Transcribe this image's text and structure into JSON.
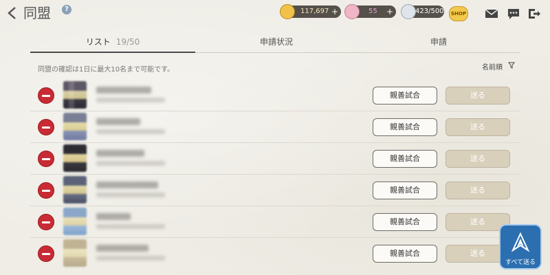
{
  "header": {
    "title": "同盟",
    "help": "?",
    "currencies": [
      {
        "name": "gold",
        "value": "117,697",
        "plus": "+"
      },
      {
        "name": "gem",
        "value": "55",
        "plus": "+"
      },
      {
        "name": "stamina",
        "value": "423/500"
      }
    ],
    "shop": "SHOP"
  },
  "tabs": [
    {
      "label": "リスト",
      "count": "19/50",
      "active": true
    },
    {
      "label": "申請状況"
    },
    {
      "label": "申請"
    }
  ],
  "notice": "同盟の確認は1日に最大10名まで可能です。",
  "sort": {
    "label": "名前順"
  },
  "rows": [
    {
      "match": "親善試合",
      "send": "送る"
    },
    {
      "match": "親善試合",
      "send": "送る"
    },
    {
      "match": "親善試合",
      "send": "送る"
    },
    {
      "match": "親善試合",
      "send": "送る"
    },
    {
      "match": "親善試合",
      "send": "送る"
    },
    {
      "match": "親善試合",
      "send": "送る"
    }
  ],
  "send_all": "すべて送る",
  "colors": {
    "remove": "#c92b34",
    "send_all": "#2c6fb0",
    "send_button": "#d9d0bc"
  }
}
